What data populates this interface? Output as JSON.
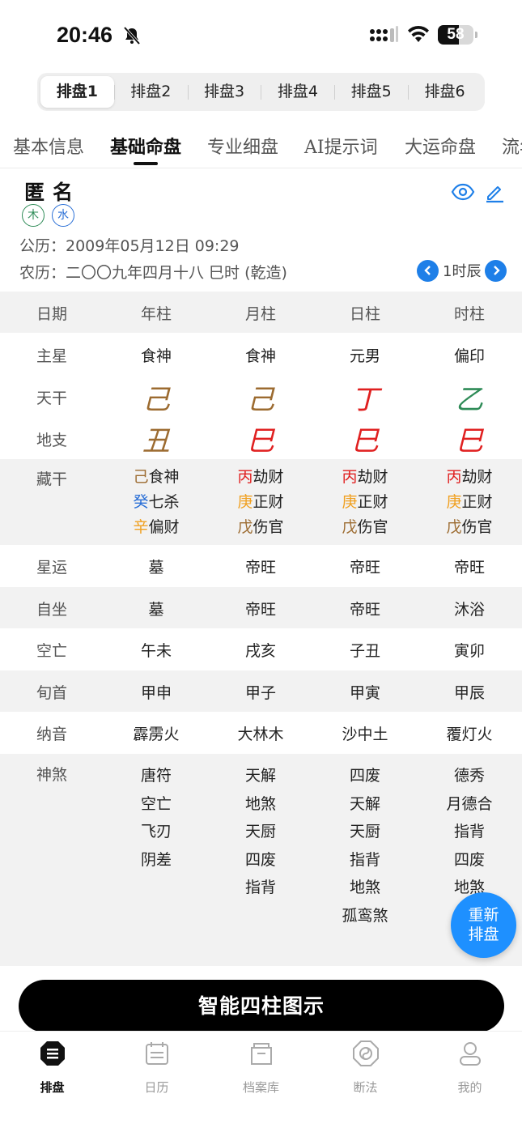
{
  "status": {
    "time": "20:46",
    "battery": "58",
    "battery_level_pct": 58
  },
  "segments": [
    "排盘1",
    "排盘2",
    "排盘3",
    "排盘4",
    "排盘5",
    "排盘6"
  ],
  "tabs": [
    "基本信息",
    "基础命盘",
    "专业细盘",
    "AI提示词",
    "大运命盘",
    "流年"
  ],
  "profile": {
    "name": "匿名",
    "elements": [
      "木",
      "水"
    ],
    "solar": "公历：2009年05月12日 09:29",
    "lunar": "农历：二〇〇九年四月十八 巳时 (乾造)",
    "hour_label": "1时辰"
  },
  "table": {
    "header": [
      "日期",
      "年柱",
      "月柱",
      "日柱",
      "时柱"
    ],
    "main_star": {
      "label": "主星",
      "values": [
        "食神",
        "食神",
        "元男",
        "偏印"
      ]
    },
    "tiangan": {
      "label": "天干",
      "values": [
        "己",
        "己",
        "丁",
        "乙"
      ],
      "colors": [
        "#9c6b30",
        "#9c6b30",
        "#e02020",
        "#2e8b57"
      ]
    },
    "dizhi": {
      "label": "地支",
      "values": [
        "丑",
        "巳",
        "巳",
        "巳"
      ],
      "colors": [
        "#9c6b30",
        "#e02020",
        "#e02020",
        "#e02020"
      ]
    },
    "canggan": {
      "label": "藏干",
      "columns": [
        [
          {
            "g": "己",
            "c": "#9c6b30",
            "s": "食神"
          },
          {
            "g": "癸",
            "c": "#2a6fd6",
            "s": "七杀"
          },
          {
            "g": "辛",
            "c": "#f0a020",
            "s": "偏财"
          }
        ],
        [
          {
            "g": "丙",
            "c": "#e02020",
            "s": "劫财"
          },
          {
            "g": "庚",
            "c": "#f0a020",
            "s": "正财"
          },
          {
            "g": "戊",
            "c": "#9c6b30",
            "s": "伤官"
          }
        ],
        [
          {
            "g": "丙",
            "c": "#e02020",
            "s": "劫财"
          },
          {
            "g": "庚",
            "c": "#f0a020",
            "s": "正财"
          },
          {
            "g": "戊",
            "c": "#9c6b30",
            "s": "伤官"
          }
        ],
        [
          {
            "g": "丙",
            "c": "#e02020",
            "s": "劫财"
          },
          {
            "g": "庚",
            "c": "#f0a020",
            "s": "正财"
          },
          {
            "g": "戊",
            "c": "#9c6b30",
            "s": "伤官"
          }
        ]
      ]
    },
    "simple_rows": [
      {
        "label": "星运",
        "values": [
          "墓",
          "帝旺",
          "帝旺",
          "帝旺"
        ]
      },
      {
        "label": "自坐",
        "values": [
          "墓",
          "帝旺",
          "帝旺",
          "沐浴"
        ]
      },
      {
        "label": "空亡",
        "values": [
          "午未",
          "戌亥",
          "子丑",
          "寅卯"
        ]
      },
      {
        "label": "旬首",
        "values": [
          "甲申",
          "甲子",
          "甲寅",
          "甲辰"
        ]
      },
      {
        "label": "纳音",
        "values": [
          "霹雳火",
          "大林木",
          "沙中土",
          "覆灯火"
        ]
      }
    ],
    "shensha": {
      "label": "神煞",
      "columns": [
        [
          "唐符",
          "空亡",
          "飞刃",
          "阴差"
        ],
        [
          "天解",
          "地煞",
          "天厨",
          "四废",
          "指背"
        ],
        [
          "四废",
          "天解",
          "天厨",
          "指背",
          "地煞",
          "孤鸾煞"
        ],
        [
          "德秀",
          "月德合",
          "指背",
          "四废",
          "地煞"
        ]
      ]
    }
  },
  "fab_label": [
    "重新",
    "排盘"
  ],
  "cta": "智能四柱图示",
  "tabbar": [
    {
      "label": "排盘",
      "icon": "paipan-icon",
      "active": true
    },
    {
      "label": "日历",
      "icon": "calendar-icon",
      "active": false
    },
    {
      "label": "档案库",
      "icon": "archive-icon",
      "active": false
    },
    {
      "label": "断法",
      "icon": "bagua-icon",
      "active": false
    },
    {
      "label": "我的",
      "icon": "profile-icon",
      "active": false
    }
  ]
}
